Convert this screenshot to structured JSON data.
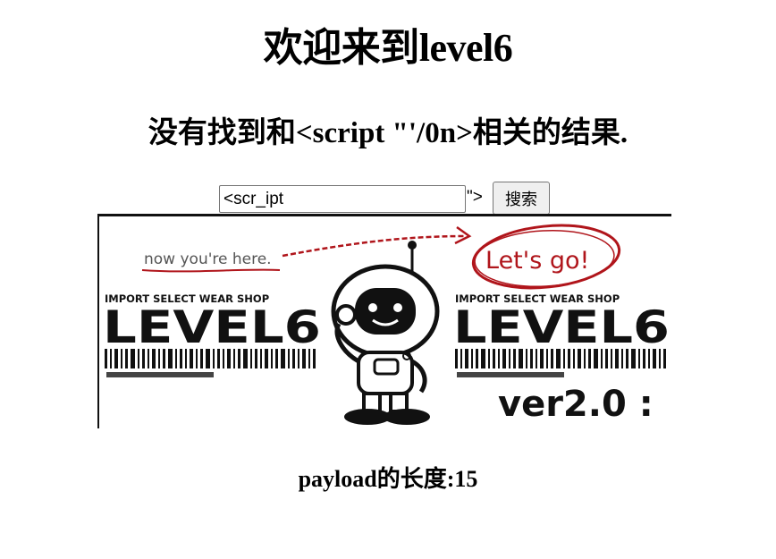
{
  "page": {
    "title": "欢迎来到level6",
    "result_message": "没有找到和<script \"'/0n>相关的结果.",
    "payload_length_text": "payload的长度:15"
  },
  "search": {
    "input_value": "<scr_ipt",
    "stray_text": "\">",
    "button_label": "搜索"
  },
  "banner": {
    "annotation_left": "now you're here.",
    "annotation_right": "Let's go!",
    "shop_label": "IMPORT SELECT WEAR SHOP",
    "level_text": "LEVEL6",
    "version_text": "ver2.0 :",
    "accent_color": "#b0151b"
  }
}
